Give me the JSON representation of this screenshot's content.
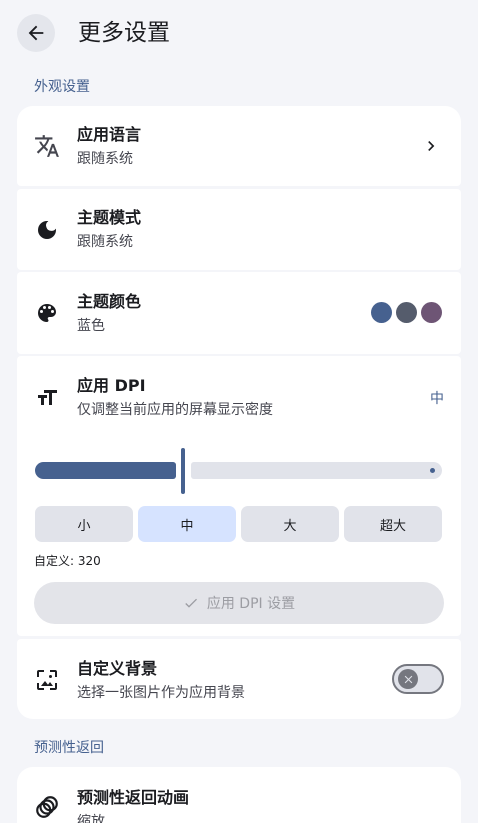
{
  "header": {
    "title": "更多设置"
  },
  "appearance": {
    "section_title": "外观设置",
    "language": {
      "title": "应用语言",
      "subtitle": "跟随系统"
    },
    "theme_mode": {
      "title": "主题模式",
      "subtitle": "跟随系统"
    },
    "theme_color": {
      "title": "主题颜色",
      "subtitle": "蓝色",
      "swatches": [
        "#46618f",
        "#555c6c",
        "#6e5575"
      ]
    },
    "dpi": {
      "title": "应用 DPI",
      "subtitle": "仅调整当前应用的屏幕显示密度",
      "current": "中",
      "options": [
        "小",
        "中",
        "大",
        "超大"
      ],
      "selected_option": "中",
      "custom_label": "自定义: 320",
      "apply_label": "应用 DPI 设置"
    },
    "background": {
      "title": "自定义背景",
      "subtitle": "选择一张图片作为应用背景",
      "enabled": false
    }
  },
  "predictive_back": {
    "section_title": "预测性返回",
    "animation": {
      "title": "预测性返回动画",
      "subtitle": "缩放"
    }
  }
}
